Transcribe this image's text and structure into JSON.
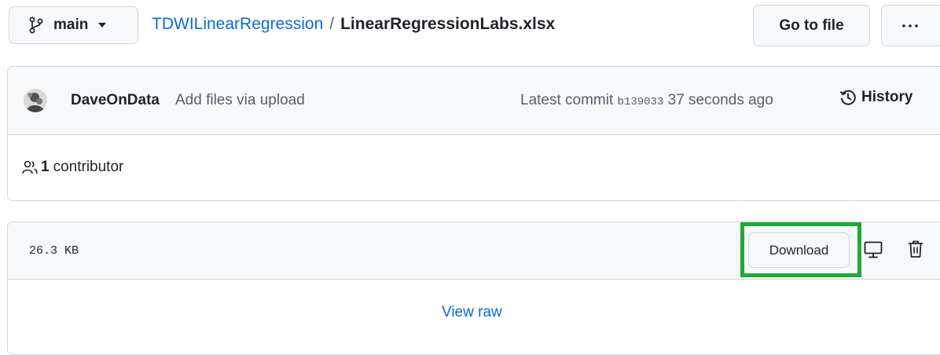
{
  "branch": {
    "name": "main",
    "branch_icon": "git-branch-icon",
    "caret_icon": "triangle-down-icon"
  },
  "breadcrumb": {
    "repo": "TDWILinearRegression",
    "separator": "/",
    "file": "LinearRegressionLabs.xlsx"
  },
  "header_actions": {
    "go_to_file": "Go to file",
    "more_icon": "kebab-horizontal-icon"
  },
  "commit": {
    "author": "DaveOnData",
    "message": "Add files via upload",
    "latest_label": "Latest commit",
    "sha": "b139033",
    "time": "37 seconds ago",
    "history_label": "History",
    "history_icon": "history-icon"
  },
  "contributors": {
    "icon": "people-icon",
    "count": "1",
    "label": "contributor"
  },
  "file": {
    "size": "26.3 KB",
    "download_label": "Download",
    "desktop_icon": "device-desktop-icon",
    "delete_icon": "trash-icon",
    "view_raw": "View raw",
    "highlight_color": "#22a83a"
  },
  "colors": {
    "link": "#0969da",
    "muted": "#57606a",
    "border": "#d0d7de",
    "subtle_bg": "#f6f8fa"
  }
}
